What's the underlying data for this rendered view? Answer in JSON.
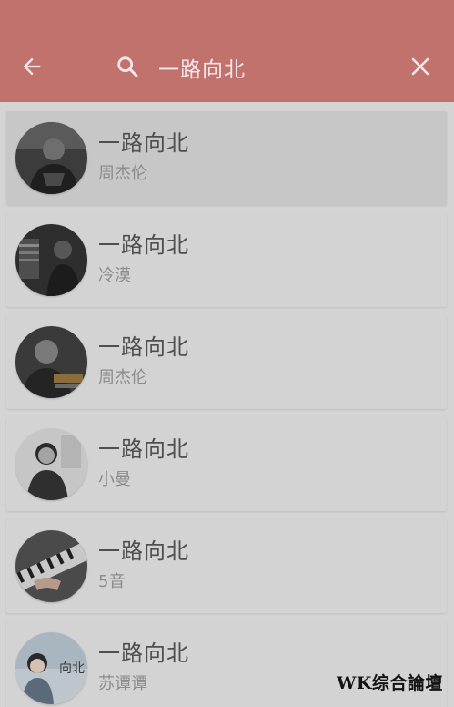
{
  "header": {
    "back_icon": "arrow-left-icon",
    "search_icon": "search-icon",
    "clear_icon": "close-icon",
    "search_value": "一路向北",
    "background_color": "#c2726d"
  },
  "results": [
    {
      "title": "一路向北",
      "artist": "周杰伦",
      "selected": true
    },
    {
      "title": "一路向北",
      "artist": "冷漠"
    },
    {
      "title": "一路向北",
      "artist": "周杰伦"
    },
    {
      "title": "一路向北",
      "artist": "小曼"
    },
    {
      "title": "一路向北",
      "artist": "5音"
    },
    {
      "title": "一路向北",
      "artist": "苏谭谭"
    }
  ],
  "watermark": "WK综合論壇"
}
